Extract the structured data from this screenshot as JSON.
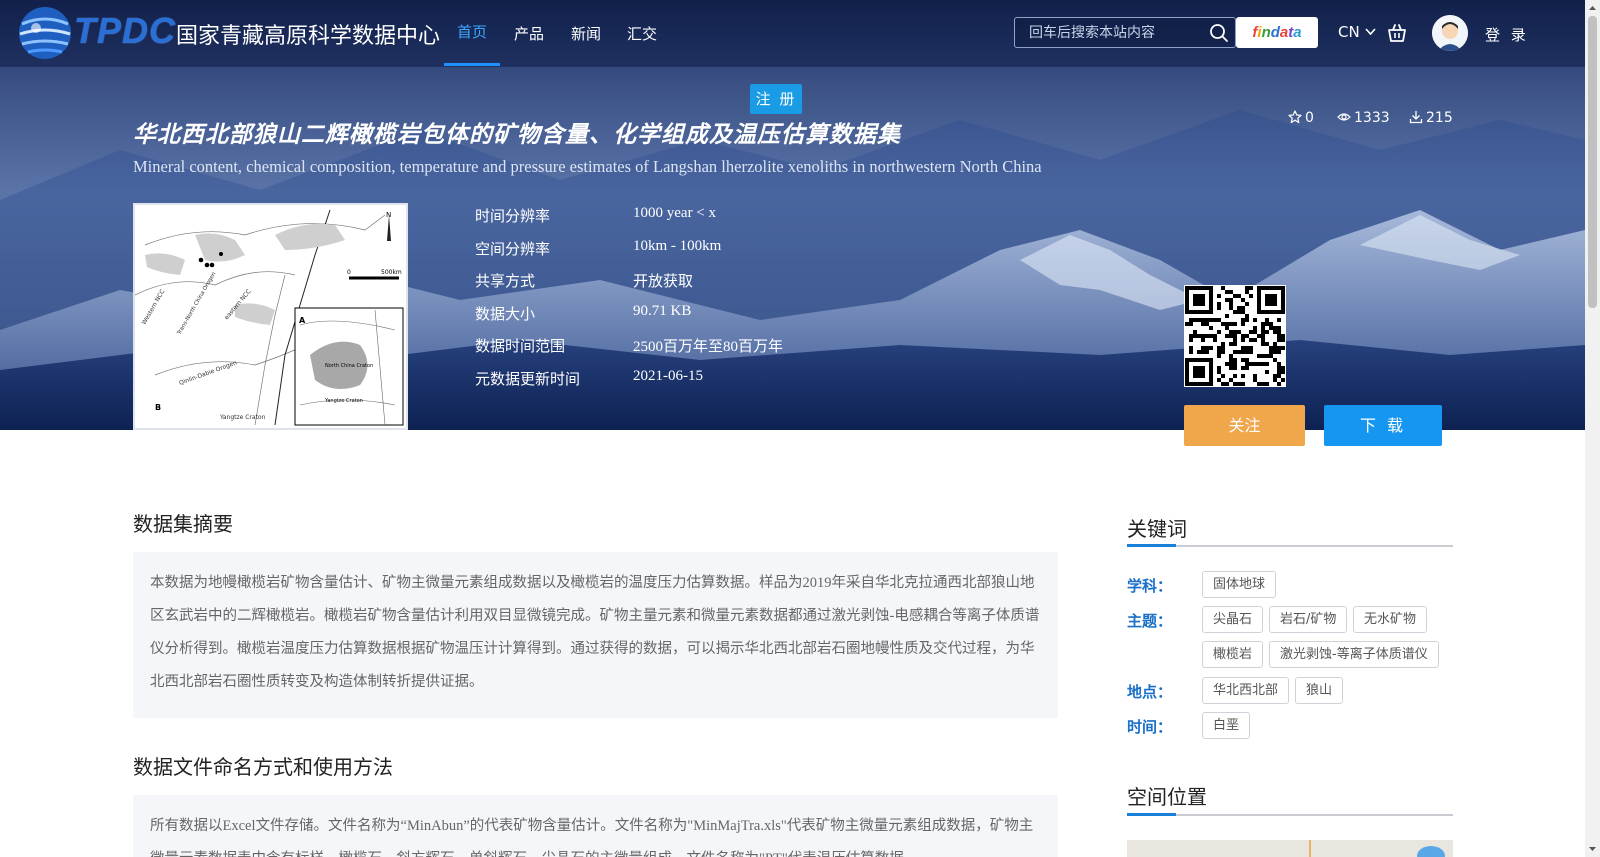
{
  "header": {
    "logo_text": "TPDC",
    "site_name": "国家青藏高原科学数据中心",
    "nav": [
      {
        "label": "首页",
        "active": true
      },
      {
        "label": "产品",
        "active": false
      },
      {
        "label": "新闻",
        "active": false
      },
      {
        "label": "汇交",
        "active": false
      }
    ],
    "search_placeholder": "回车后搜索本站内容",
    "findata": "findata",
    "lang": "CN",
    "login": "登 录"
  },
  "register_label": "注 册",
  "dataset": {
    "title_cn": "华北西北部狼山二辉橄榄岩包体的矿物含量、化学组成及温压估算数据集",
    "title_en": "Mineral content, chemical composition, temperature and pressure estimates of Langshan lherzolite xenoliths in northwestern North China",
    "stats": {
      "favorites": "0",
      "views": "1333",
      "downloads": "215"
    },
    "meta": [
      {
        "label": "时间分辨率",
        "value": "1000 year < x"
      },
      {
        "label": "空间分辨率",
        "value": "10km - 100km"
      },
      {
        "label": "共享方式",
        "value": "开放获取"
      },
      {
        "label": "数据大小",
        "value": "90.71 KB"
      },
      {
        "label": "数据时间范围",
        "value": "2500百万年至80百万年"
      },
      {
        "label": "元数据更新时间",
        "value": "2021-06-15"
      }
    ],
    "follow_label": "关注",
    "download_label": "下 载"
  },
  "thumbnail": {
    "labels": {
      "north": "N",
      "scale_zero": "0",
      "scale_end": "500km",
      "western_ncc": "Western NCC",
      "trans_north_china_orogen": "Trans-North China Orogen",
      "eastern_ncc": "eastern NCC",
      "panel_a": "A",
      "panel_b": "B",
      "qinlin_dabie": "Qinlin-Dabie Orogen",
      "yangtze_craton_b": "Yangtze Craton",
      "north_china_craton": "North China Craton",
      "yangtze_craton_a": "Yangtze Craton"
    }
  },
  "abstract": {
    "title": "数据集摘要",
    "text": "本数据为地幔橄榄岩矿物含量估计、矿物主微量元素组成数据以及橄榄岩的温度压力估算数据。样品为2019年采自华北克拉通西北部狼山地区玄武岩中的二辉橄榄岩。橄榄岩矿物含量估计利用双目显微镜完成。矿物主量元素和微量元素数据都通过激光剥蚀-电感耦合等离子体质谱仪分析得到。橄榄岩温度压力估算数据根据矿物温压计计算得到。通过获得的数据，可以揭示华北西北部岩石圈地幔性质及交代过程，为华北西北部岩石圈性质转变及构造体制转折提供证据。"
  },
  "naming": {
    "title": "数据文件命名方式和使用方法",
    "text": "所有数据以Excel文件存储。文件名称为“MinAbun”的代表矿物含量估计。文件名称为\"MinMajTra.xls\"代表矿物主微量元素组成数据，矿物主微量元素数据表中含有标样、橄榄石、斜方辉石、单斜辉石、尖晶石的主微量组成。文件名称为\"PT\"代表温压估算数据。"
  },
  "keywords": {
    "title": "关键词",
    "groups": [
      {
        "label": "学科：",
        "tags": [
          "固体地球"
        ]
      },
      {
        "label": "主题：",
        "tags": [
          "尖晶石",
          "岩石/矿物",
          "无水矿物",
          "橄榄岩",
          "激光剥蚀-等离子体质谱仪"
        ]
      },
      {
        "label": "地点：",
        "tags": [
          "华北西北部",
          "狼山"
        ]
      },
      {
        "label": "时间：",
        "tags": [
          "白垩"
        ]
      }
    ]
  },
  "spatial": {
    "title": "空间位置"
  },
  "colors": {
    "accent": "#1a9be6",
    "follow": "#f0a64b",
    "download": "#1596f0",
    "keyword_label": "#1a6fc8",
    "nav_active": "#3ea6ff"
  },
  "icons": [
    "search-icon",
    "cart-icon",
    "star-icon",
    "eye-icon",
    "download-icon",
    "chevron-down-icon",
    "avatar"
  ]
}
